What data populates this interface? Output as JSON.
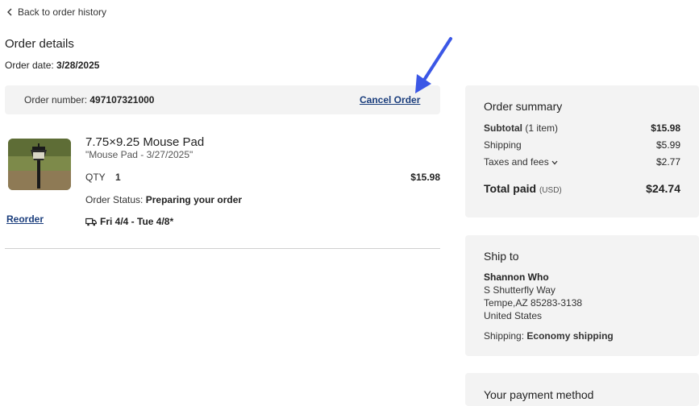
{
  "back_link": "Back to order history",
  "page_title": "Order details",
  "order_date": {
    "label": "Order date:",
    "value": "3/28/2025"
  },
  "order_number": {
    "label": "Order number:",
    "value": "497107321000"
  },
  "cancel_label": "Cancel Order",
  "item": {
    "name": "7.75×9.25 Mouse Pad",
    "subtitle": "\"Mouse Pad - 3/27/2025\"",
    "qty_label": "QTY",
    "qty": "1",
    "price": "$15.98",
    "status_label": "Order Status:",
    "status": "Preparing your order",
    "reorder_label": "Reorder",
    "delivery": "Fri 4/4 - Tue 4/8*"
  },
  "summary": {
    "title": "Order summary",
    "subtotal_label": "Subtotal",
    "subtotal_count": "(1 item)",
    "subtotal_value": "$15.98",
    "shipping_label": "Shipping",
    "shipping_value": "$5.99",
    "taxes_label": "Taxes and fees",
    "taxes_value": "$2.77",
    "total_label": "Total paid",
    "total_currency": "(USD)",
    "total_value": "$24.74"
  },
  "ship_to": {
    "title": "Ship to",
    "name": "Shannon Who",
    "street": "S Shutterfly Way",
    "city": "Tempe,AZ 85283-3138",
    "country": "United States",
    "method_label": "Shipping:",
    "method": "Economy shipping"
  },
  "payment": {
    "title": "Your payment method"
  },
  "colors": {
    "link": "#1a3d7c",
    "arrow": "#3b57e6",
    "panel": "#f3f3f3"
  }
}
